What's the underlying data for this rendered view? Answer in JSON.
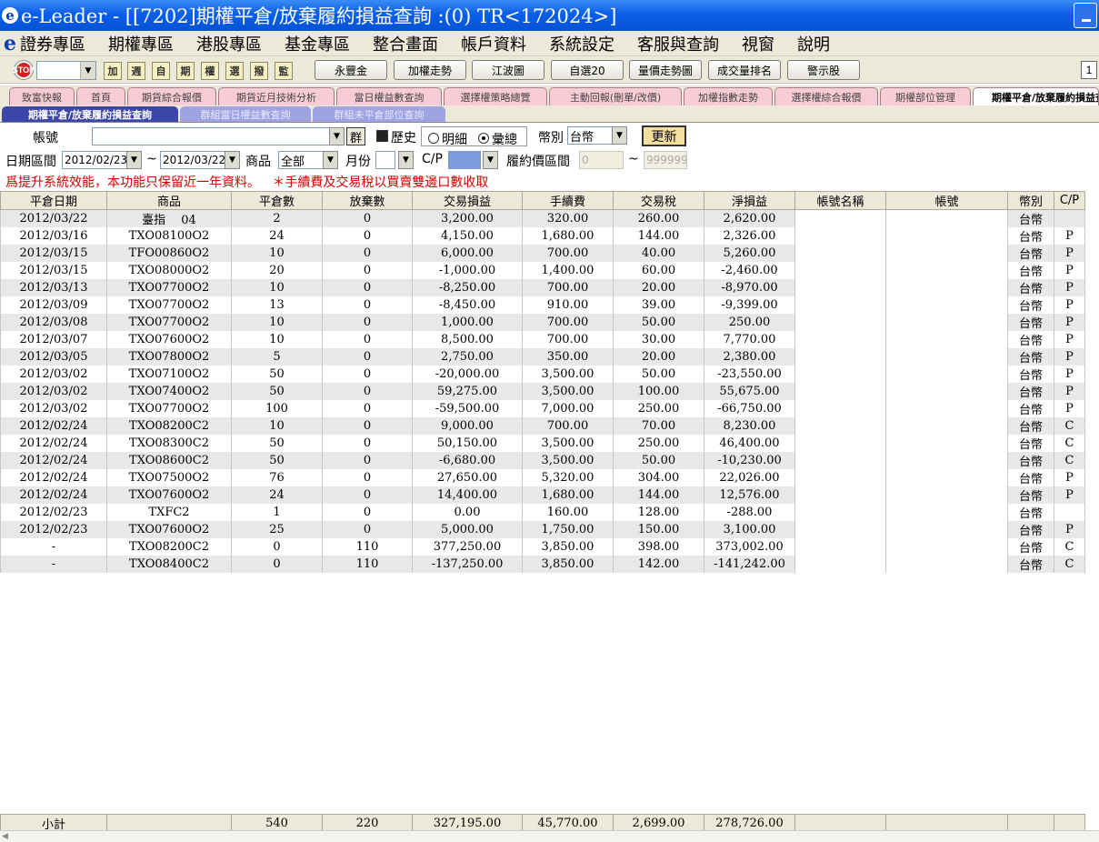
{
  "window": {
    "title": "e-Leader - [[7202]期權平倉/放棄履約損益查詢 :(0) TR<172024>]"
  },
  "menu": [
    "證券專區",
    "期權專區",
    "港股專區",
    "基金專區",
    "整合畫面",
    "帳戶資料",
    "系統設定",
    "客服與查詢",
    "視窗",
    "說明"
  ],
  "toolbar": {
    "stop_label": "STOP",
    "icons": [
      "加",
      "週",
      "自",
      "期",
      "權",
      "選",
      "撥",
      "監"
    ],
    "buttons": [
      "永豐金",
      "加權走勢",
      "江波圖",
      "自選20",
      "量價走勢圖",
      "成交量排名",
      "警示股"
    ],
    "right_label": "1"
  },
  "tabs": [
    "致富快報",
    "首頁",
    "期貨綜合報價",
    "期貨近月技術分析",
    "當日權益數查詢",
    "選擇權策略總覽",
    "主動回報(刪單/改價)",
    "加權指數走勢",
    "選擇權綜合報價",
    "期權部位管理",
    "期權平倉/放棄履約損益查詢"
  ],
  "subtabs": [
    "期權平倉/放棄履約損益查詢",
    "群組當日權益數查詢",
    "群組未平倉部位查詢"
  ],
  "form": {
    "account_label": "帳號",
    "account_value": "",
    "group_button": "群",
    "history_label": "歷史",
    "detail_label": "明細",
    "summary_label": "彙總",
    "currency_label": "幣別",
    "currency_value": "台幣",
    "update_button": "更新",
    "date_label": "日期區間",
    "date_from": "2012/02/23",
    "tilde": "~",
    "date_to": "2012/03/22",
    "product_label": "商品",
    "product_value": "全部",
    "month_label": "月份",
    "month_value": "",
    "cp_label": "C/P",
    "cp_value": "",
    "strike_label": "履約價區間",
    "strike_from": "0",
    "strike_to": "999999",
    "note1": "爲提升系統效能，本功能只保留近一年資料。",
    "note2": "＊手續費及交易稅以買賣雙邊口數收取"
  },
  "table": {
    "headers": [
      "平倉日期",
      "商品",
      "平倉數",
      "放棄數",
      "交易損益",
      "手續費",
      "交易稅",
      "淨損益",
      "帳號名稱",
      "帳號",
      "幣別",
      "C/P"
    ],
    "rows": [
      [
        "2012/03/22",
        "臺指　 04",
        "2",
        "0",
        "3,200.00",
        "320.00",
        "260.00",
        "2,620.00",
        "",
        "",
        "台幣",
        ""
      ],
      [
        "2012/03/16",
        "TXO08100O2",
        "24",
        "0",
        "4,150.00",
        "1,680.00",
        "144.00",
        "2,326.00",
        "",
        "",
        "台幣",
        "P"
      ],
      [
        "2012/03/15",
        "TFO00860O2",
        "10",
        "0",
        "6,000.00",
        "700.00",
        "40.00",
        "5,260.00",
        "",
        "",
        "台幣",
        "P"
      ],
      [
        "2012/03/15",
        "TXO08000O2",
        "20",
        "0",
        "-1,000.00",
        "1,400.00",
        "60.00",
        "-2,460.00",
        "",
        "",
        "台幣",
        "P"
      ],
      [
        "2012/03/13",
        "TXO07700O2",
        "10",
        "0",
        "-8,250.00",
        "700.00",
        "20.00",
        "-8,970.00",
        "",
        "",
        "台幣",
        "P"
      ],
      [
        "2012/03/09",
        "TXO07700O2",
        "13",
        "0",
        "-8,450.00",
        "910.00",
        "39.00",
        "-9,399.00",
        "",
        "",
        "台幣",
        "P"
      ],
      [
        "2012/03/08",
        "TXO07700O2",
        "10",
        "0",
        "1,000.00",
        "700.00",
        "50.00",
        "250.00",
        "",
        "",
        "台幣",
        "P"
      ],
      [
        "2012/03/07",
        "TXO07600O2",
        "10",
        "0",
        "8,500.00",
        "700.00",
        "30.00",
        "7,770.00",
        "",
        "",
        "台幣",
        "P"
      ],
      [
        "2012/03/05",
        "TXO07800O2",
        "5",
        "0",
        "2,750.00",
        "350.00",
        "20.00",
        "2,380.00",
        "",
        "",
        "台幣",
        "P"
      ],
      [
        "2012/03/02",
        "TXO07100O2",
        "50",
        "0",
        "-20,000.00",
        "3,500.00",
        "50.00",
        "-23,550.00",
        "",
        "",
        "台幣",
        "P"
      ],
      [
        "2012/03/02",
        "TXO07400O2",
        "50",
        "0",
        "59,275.00",
        "3,500.00",
        "100.00",
        "55,675.00",
        "",
        "",
        "台幣",
        "P"
      ],
      [
        "2012/03/02",
        "TXO07700O2",
        "100",
        "0",
        "-59,500.00",
        "7,000.00",
        "250.00",
        "-66,750.00",
        "",
        "",
        "台幣",
        "P"
      ],
      [
        "2012/02/24",
        "TXO08200C2",
        "10",
        "0",
        "9,000.00",
        "700.00",
        "70.00",
        "8,230.00",
        "",
        "",
        "台幣",
        "C"
      ],
      [
        "2012/02/24",
        "TXO08300C2",
        "50",
        "0",
        "50,150.00",
        "3,500.00",
        "250.00",
        "46,400.00",
        "",
        "",
        "台幣",
        "C"
      ],
      [
        "2012/02/24",
        "TXO08600C2",
        "50",
        "0",
        "-6,680.00",
        "3,500.00",
        "50.00",
        "-10,230.00",
        "",
        "",
        "台幣",
        "C"
      ],
      [
        "2012/02/24",
        "TXO07500O2",
        "76",
        "0",
        "27,650.00",
        "5,320.00",
        "304.00",
        "22,026.00",
        "",
        "",
        "台幣",
        "P"
      ],
      [
        "2012/02/24",
        "TXO07600O2",
        "24",
        "0",
        "14,400.00",
        "1,680.00",
        "144.00",
        "12,576.00",
        "",
        "",
        "台幣",
        "P"
      ],
      [
        "2012/02/23",
        "TXFC2",
        "1",
        "0",
        "0.00",
        "160.00",
        "128.00",
        "-288.00",
        "",
        "",
        "台幣",
        ""
      ],
      [
        "2012/02/23",
        "TXO07600O2",
        "25",
        "0",
        "5,000.00",
        "1,750.00",
        "150.00",
        "3,100.00",
        "",
        "",
        "台幣",
        "P"
      ],
      [
        "-",
        "TXO08200C2",
        "0",
        "110",
        "377,250.00",
        "3,850.00",
        "398.00",
        "373,002.00",
        "",
        "",
        "台幣",
        "C"
      ],
      [
        "-",
        "TXO08400C2",
        "0",
        "110",
        "-137,250.00",
        "3,850.00",
        "142.00",
        "-141,242.00",
        "",
        "",
        "台幣",
        "C"
      ]
    ],
    "footer": [
      "小計",
      "",
      "540",
      "220",
      "327,195.00",
      "45,770.00",
      "2,699.00",
      "278,726.00",
      "",
      "",
      "",
      ""
    ]
  }
}
